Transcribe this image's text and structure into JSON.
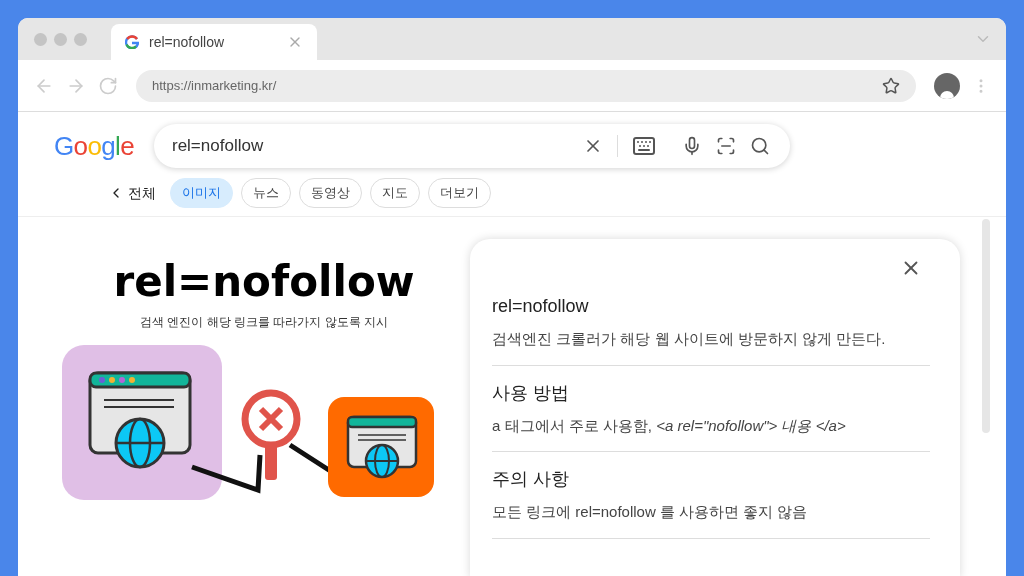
{
  "tab": {
    "title": "rel=nofollow"
  },
  "address_bar": {
    "url": "https://inmarketing.kr/"
  },
  "search": {
    "logo": "Google",
    "query": "rel=nofollow"
  },
  "filters": {
    "back_label": "전체",
    "chips": [
      {
        "label": "이미지",
        "selected": true
      },
      {
        "label": "뉴스",
        "selected": false
      },
      {
        "label": "동영상",
        "selected": false
      },
      {
        "label": "지도",
        "selected": false
      },
      {
        "label": "더보기",
        "selected": false
      }
    ]
  },
  "image": {
    "title": "rel=nofollow",
    "subtitle": "검색 엔진이 해당 링크를 따라가지 않도록 지시"
  },
  "panel": {
    "sections": [
      {
        "heading": "rel=nofollow",
        "text": "검색엔진 크롤러가 해당 웹 사이트에 방문하지 않게 만든다."
      },
      {
        "heading": "사용 방법",
        "text": "a 태그에서 주로 사용함, *<a rel=\"nofollow\"> 내용 </a>*"
      },
      {
        "heading": "주의 사항",
        "text": "모든 링크에 rel=nofollow 를 사용하면 좋지 않음"
      }
    ]
  }
}
